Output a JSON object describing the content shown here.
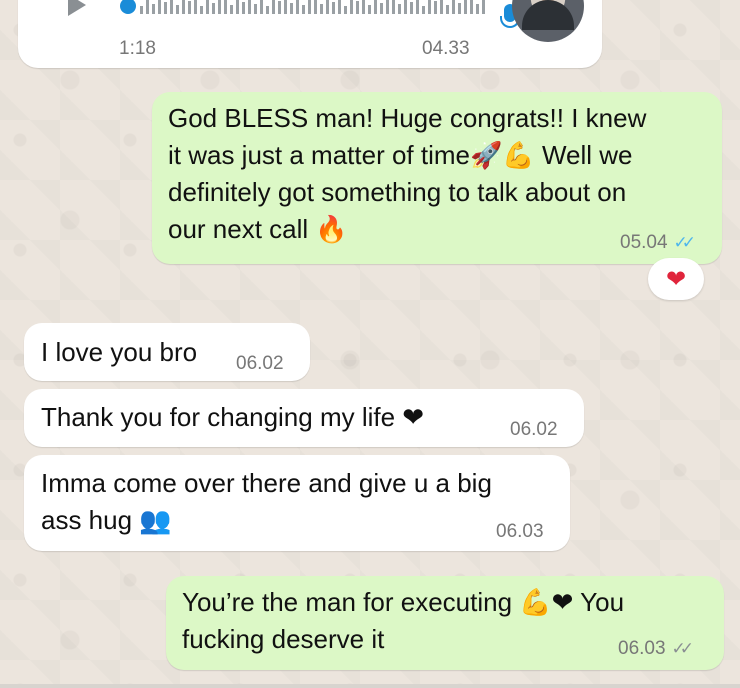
{
  "voice_message": {
    "duration": "1:18",
    "time": "04.33"
  },
  "messages": [
    {
      "side": "out",
      "text_lines": [
        "God BLESS man! Huge congrats!! I knew",
        "it was just a matter of time🚀💪 Well we",
        "definitely got something to talk about on",
        "our next call 🔥"
      ],
      "time": "05.04",
      "ticks": "✓✓",
      "reaction": "❤"
    },
    {
      "side": "in",
      "text": "I love you bro",
      "time": "06.02"
    },
    {
      "side": "in",
      "text": "Thank you for changing my life ❤",
      "time": "06.02"
    },
    {
      "side": "in",
      "text_lines": [
        "Imma come over there and give u a big",
        "ass hug 👥"
      ],
      "time": "06.03"
    },
    {
      "side": "out",
      "text_lines": [
        "You’re the man for executing 💪❤ You",
        "fucking deserve it"
      ],
      "time": "06.03",
      "ticks": "✓✓"
    }
  ],
  "colors": {
    "incoming": "#ffffff",
    "outgoing": "#dcf8c6",
    "read_ticks": "#4fb6ec",
    "delivered_ticks": "#8a8f93",
    "heart": "#e0243b"
  }
}
